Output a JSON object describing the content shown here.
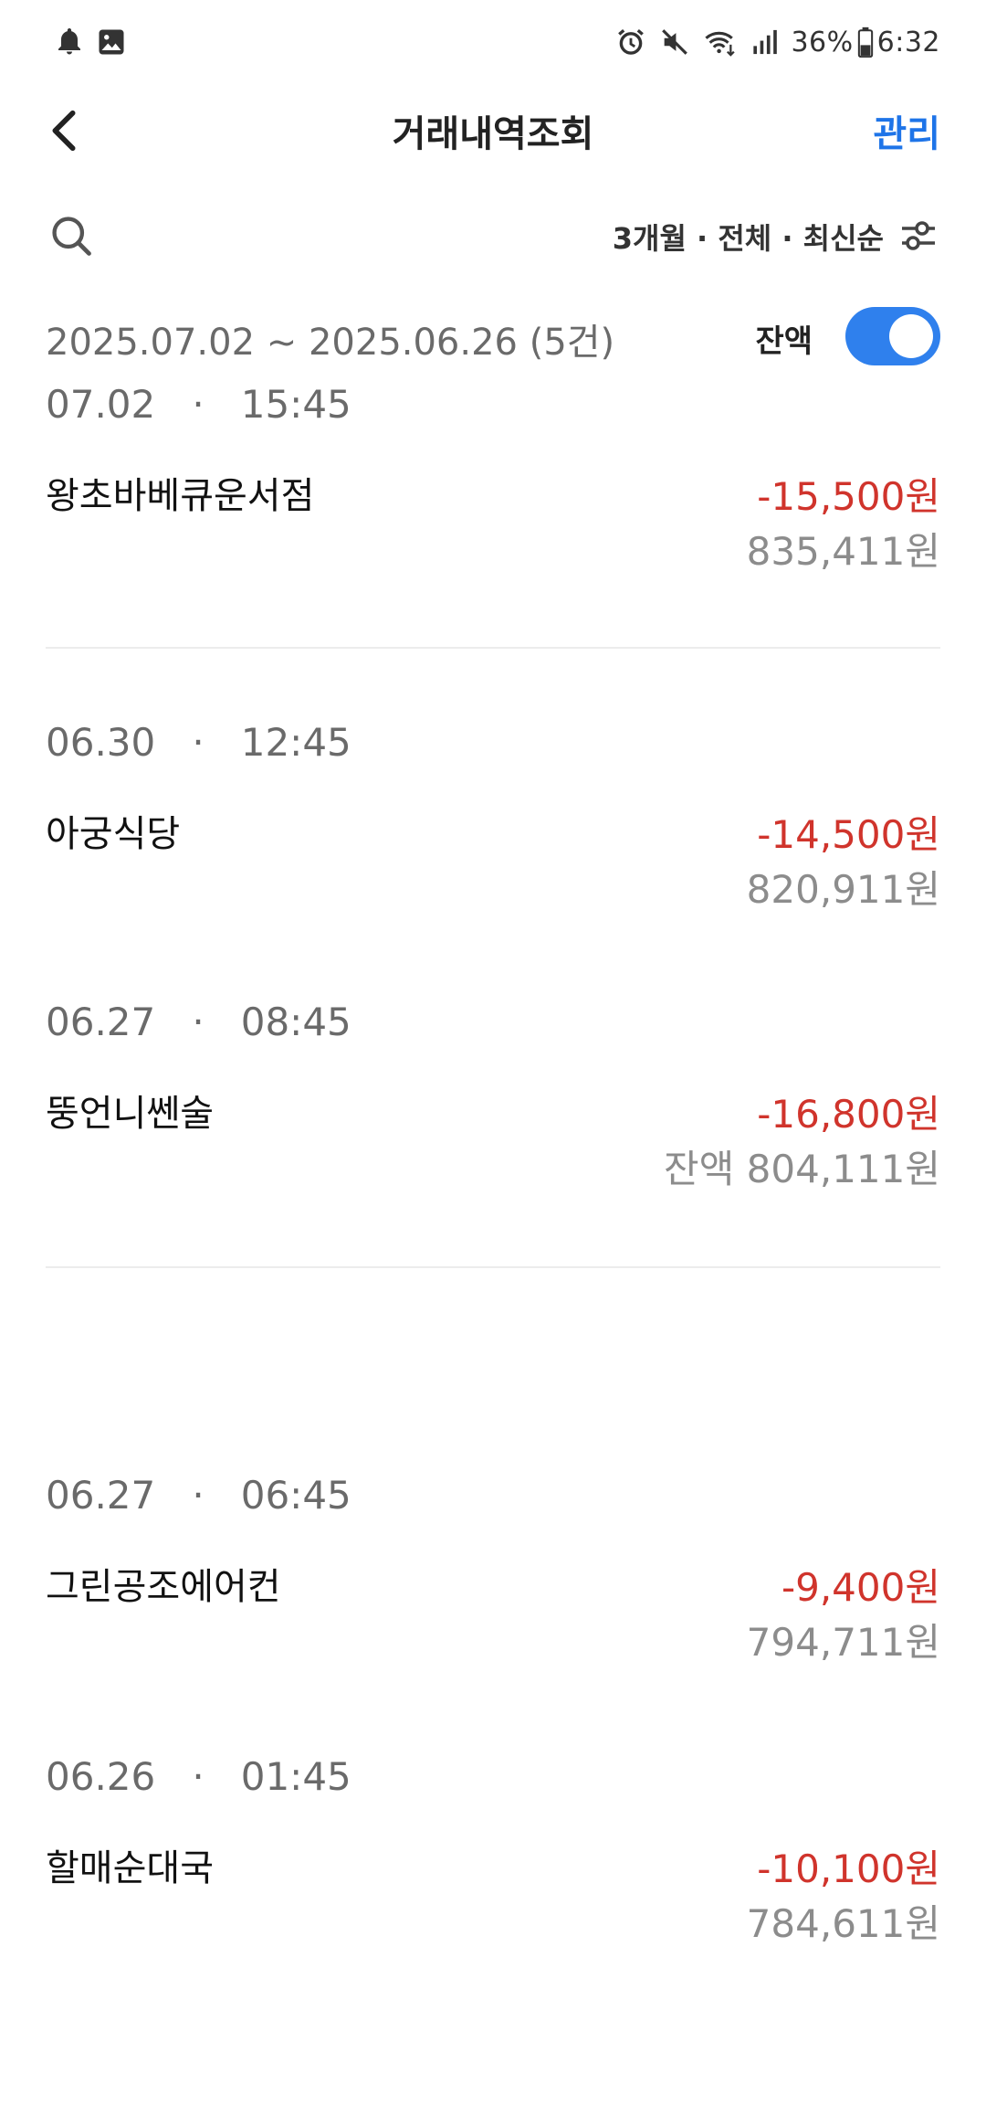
{
  "status_bar": {
    "battery": "36%",
    "time": "6:32",
    "left_icons": [
      "bell-icon",
      "image-icon"
    ],
    "right_icons": [
      "alarm-icon",
      "mute-icon",
      "wifi-icon",
      "signal-icon",
      "battery-icon"
    ]
  },
  "header": {
    "title": "거래내역조회",
    "manage_label": "관리",
    "back_icon": "chevron-left-icon"
  },
  "filter": {
    "summary": "3개월 · 전체 · 최신순",
    "search_icon": "search-icon",
    "filter_icon": "filter-settings-icon"
  },
  "range": {
    "text": "2025.07.02 ~ 2025.06.26 (5건)",
    "balance_toggle_label": "잔액",
    "balance_toggle_on": true
  },
  "transactions": [
    {
      "date": "07.02",
      "sep": "·",
      "time": "15:45",
      "merchant": "왕초바베큐운서점",
      "amount": "-15,500원",
      "balance": "835,411원"
    },
    {
      "date": "06.30",
      "sep": "·",
      "time": "12:45",
      "merchant": "아궁식당",
      "amount": "-14,500원",
      "balance": "820,911원"
    },
    {
      "date": "06.27",
      "sep": "·",
      "time": "08:45",
      "merchant": "뚱언니쎈술",
      "amount": "-16,800원",
      "balance": "잔액 804,111원"
    },
    {
      "date": "06.27",
      "sep": "·",
      "time": "06:45",
      "merchant": "그린공조에어컨",
      "amount": "-9,400원",
      "balance": "794,711원"
    },
    {
      "date": "06.26",
      "sep": "·",
      "time": "01:45",
      "merchant": "할매순대국",
      "amount": "-10,100원",
      "balance": "784,611원"
    }
  ],
  "colors": {
    "accent": "#1e74e8",
    "toggle": "#2f80ed",
    "debit": "#d0342c",
    "muted": "#8c8c8c"
  }
}
